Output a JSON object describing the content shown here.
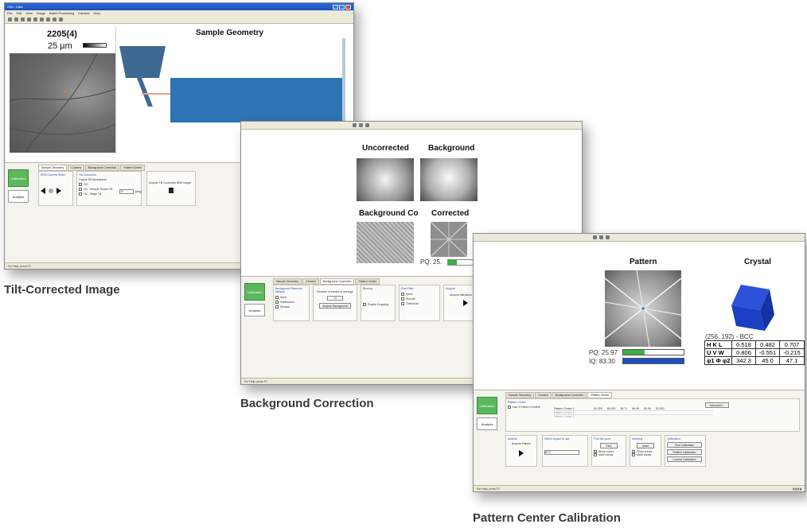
{
  "windows": {
    "tilt": {
      "title_bar": "OIM - Data",
      "menu": [
        "File",
        "Edit",
        "View",
        "Image",
        "Batch Processing",
        "Camera",
        "Help"
      ],
      "sample_name": "2205(4)",
      "scale_label": "25 µm",
      "geometry_title": "Sample Geometry",
      "tabs": [
        "Sample Geometry",
        "Camera",
        "Background Correction",
        "Pattern Center"
      ],
      "calibration_label": "Calibration",
      "analysis_label": "Analysis",
      "group_rotate": "SEM Camera Slider",
      "group_tilt": "Tilt Correction",
      "tilt_sub": "Output Tilt Mechanism",
      "opt_off": "Off",
      "opt_on_x": "On - Sample Holder Tilt",
      "opt_on_stage": "On - Stage Tilt",
      "tilt_value": "70",
      "deg": "(deg)",
      "acquire_label": "Acquire Tilt Corrected SEM Image",
      "status": "For Help, press F1"
    },
    "background": {
      "panels": [
        "Uncorrected",
        "Background",
        "Background Co",
        "Corrected"
      ],
      "pq": "PQ: 25.",
      "pq_fill": 0.3,
      "tabs": [
        "Sample Geometry",
        "Camera",
        "Background Correction",
        "Pattern Center"
      ],
      "calibration_label": "Calibration",
      "analysis_label": "Analysis",
      "method_title": "Background Removal Method",
      "method_opts": [
        "None",
        "Subtraction",
        "Division"
      ],
      "frames_label": "Number of frames to average",
      "frames_value": "10",
      "acquire_bg": "Acquire Background",
      "binning_title": "Binning",
      "enable_cropping": "Enable Cropping",
      "filter_title": "Post Filter",
      "filter_opts": [
        "None",
        "Smooth",
        "Threshold"
      ],
      "acquire_pattern_title": "Acquire",
      "acquire_pattern": "Acquire diffraction pattern",
      "status": "For Help, press F1"
    },
    "pattern": {
      "pattern_title": "Pattern",
      "crystal_title": "Crystal",
      "pq": "PQ: 25.97",
      "iq": "IQ: 83.30",
      "pq_fill": 0.35,
      "iq_fill": 1.0,
      "solution": "(256, 192) - BCC",
      "table": [
        [
          "H K L",
          "0.518",
          "0.482",
          "0.707"
        ],
        [
          "U V W",
          "0.806",
          "-0.551",
          "-0.215"
        ],
        [
          "φ1 Φ φ2",
          "342.3",
          "45.0",
          "47.1"
        ]
      ],
      "tabs": [
        "Sample Geometry",
        "Camera",
        "Background Correction",
        "Pattern Center"
      ],
      "calibration_label": "Calibration",
      "analysis_label": "Analysis",
      "pc_title": "Pattern Center",
      "use_3": "Use 3 Pattern Centers",
      "advanced": "Advanced...",
      "pc_rows": [
        "Pattern Center 1",
        "Pattern Center 2",
        "Pattern Center 3"
      ],
      "pc_values": [
        "60.000",
        "50.000",
        "56.71",
        "66.99",
        "66.99",
        "30.000"
      ],
      "acquire_title": "Acquire",
      "acquire_pattern": "Acquire Pattern",
      "material_title": "Select crystal to use",
      "material": "BCC",
      "find_title": "Find the zone",
      "find_btn": "Find",
      "show_zones": "Show zones",
      "mark_bands": "Mark bands",
      "indexing": "Indexing",
      "index_btn": "Index",
      "calibration_title": "Calibration",
      "fine_cal": "Fine Calibration",
      "pattern_cal": "Pattern Calibration",
      "current_cal": "Current Calibration",
      "status": "For Help, press F1"
    }
  },
  "captions": {
    "tilt": "Tilt-Corrected Image",
    "background": "Background Correction",
    "pattern": "Pattern Center Calibration"
  },
  "colors": {
    "calibration_green": "#5cb85c",
    "geometry_blue": "#2d74b5",
    "progress_green": "#3cb043",
    "progress_blue": "#1f4fbf",
    "cube_blue": "#1a3fc4"
  }
}
